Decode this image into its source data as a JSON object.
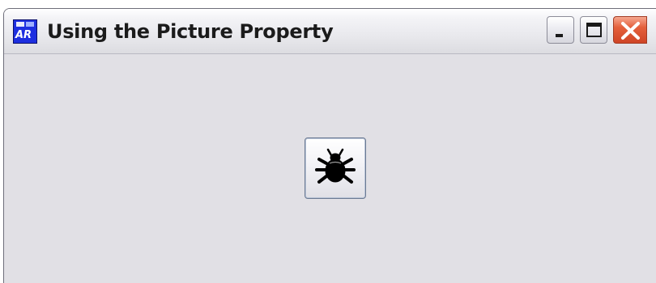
{
  "window": {
    "title": "Using the Picture Property",
    "app_icon": "app-window-icon"
  },
  "title_controls": {
    "minimize_icon": "minimize-icon",
    "maximize_icon": "maximize-icon",
    "close_icon": "close-icon"
  },
  "main": {
    "picture_button": {
      "icon": "bug-icon"
    }
  },
  "colors": {
    "client_background": "#e1e0e5",
    "close_button": "#e4603c"
  }
}
